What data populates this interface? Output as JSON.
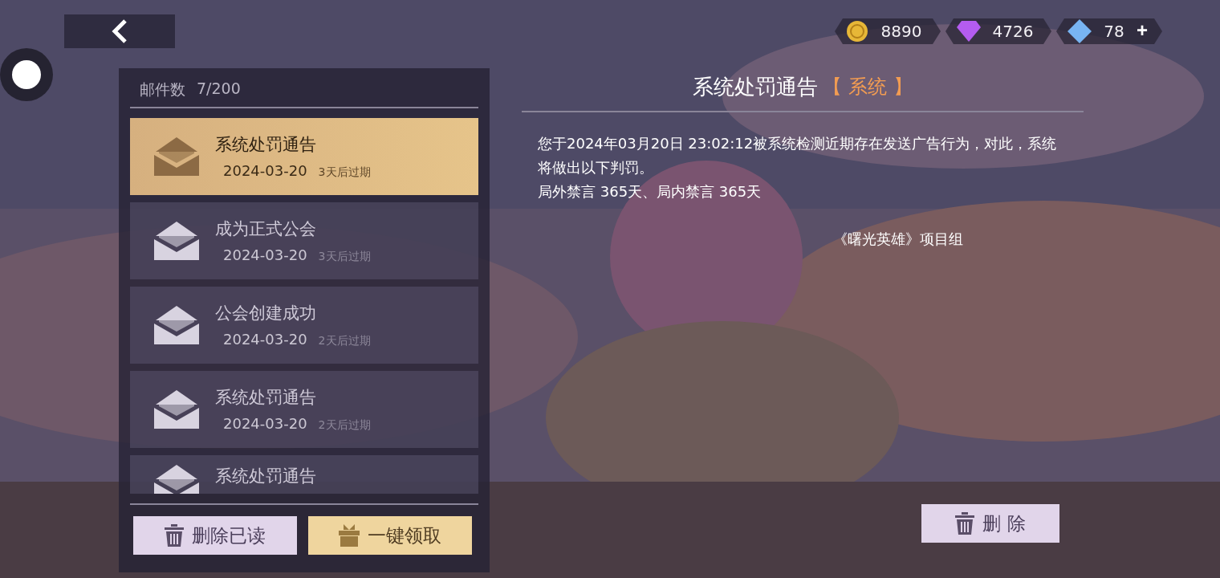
{
  "currencies": [
    {
      "kind": "coin",
      "amount": "8890"
    },
    {
      "kind": "gem",
      "amount": "4726"
    },
    {
      "kind": "crystal",
      "amount": "78",
      "add": "+"
    }
  ],
  "mail_panel": {
    "count_label": "邮件数",
    "count": "7/200",
    "items": [
      {
        "title": "系统处罚通告",
        "date": "2024-03-20",
        "expiry": "3天后过期",
        "selected": true
      },
      {
        "title": "成为正式公会",
        "date": "2024-03-20",
        "expiry": "3天后过期",
        "selected": false
      },
      {
        "title": "公会创建成功",
        "date": "2024-03-20",
        "expiry": "2天后过期",
        "selected": false
      },
      {
        "title": "系统处罚通告",
        "date": "2024-03-20",
        "expiry": "2天后过期",
        "selected": false
      },
      {
        "title": "系统处罚通告",
        "selected": false
      }
    ],
    "buttons": [
      {
        "kind": "delete",
        "label": "删除已读"
      },
      {
        "kind": "claim",
        "label": "一键领取"
      }
    ]
  },
  "detail": {
    "title": "系统处罚通告",
    "tag": "【 系统 】",
    "body": [
      "您于2024年03月20日 23:02:12被系统检测近期存在发送广告行为，对此，系统将做出以下判罚。",
      "局外禁言 365天、局内禁言 365天"
    ],
    "signature": "《曙光英雄》项目组",
    "delete_button": "删 除"
  }
}
